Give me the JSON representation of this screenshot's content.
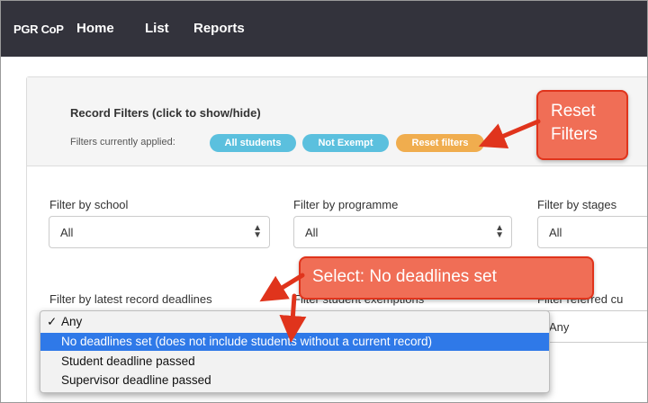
{
  "navbar": {
    "brand": "PGR CoP",
    "items": [
      {
        "label": "Home"
      },
      {
        "label": "List"
      },
      {
        "label": "Reports"
      }
    ]
  },
  "record_filters": {
    "title": "Record Filters (click to show/hide)",
    "applied_label": "Filters currently applied:",
    "pills": [
      {
        "label": "All students",
        "color": "#5bc0de"
      },
      {
        "label": "Not Exempt",
        "color": "#5bc0de"
      },
      {
        "label": "Reset filters",
        "color": "#f0ad4e"
      }
    ]
  },
  "filters": {
    "school": {
      "label": "Filter by school",
      "value": "All"
    },
    "programme": {
      "label": "Filter by programme",
      "value": "All"
    },
    "stages": {
      "label": "Filter by stages",
      "value": "All"
    },
    "deadlines": {
      "label": "Filter by latest record deadlines"
    },
    "exemptions": {
      "label": "Filter student exemptions"
    },
    "referred": {
      "label": "Filter referred cu",
      "value": "Any"
    }
  },
  "dropdown": {
    "options": [
      {
        "label": "Any",
        "checked": true
      },
      {
        "label": "No deadlines set (does not include students without a current record)",
        "highlighted": true
      },
      {
        "label": "Student deadline passed"
      },
      {
        "label": "Supervisor deadline passed"
      }
    ],
    "check_mark": "✓"
  },
  "annotations": {
    "reset_callout": {
      "line1": "Reset",
      "line2": "Filters"
    },
    "select_callout": "Select: No deadlines set",
    "callout_color": "#f06e56",
    "arrow_color": "#e0341c"
  }
}
